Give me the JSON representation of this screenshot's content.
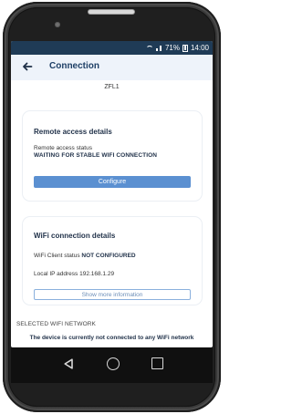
{
  "status_bar": {
    "battery": "71%",
    "time": "14:00"
  },
  "header": {
    "title": "Connection"
  },
  "device": {
    "name": "ZFL1"
  },
  "remote_access": {
    "title": "Remote access details",
    "status_label": "Remote access status",
    "status_value": "WAITING FOR STABLE WIFI CONNECTION",
    "configure_label": "Configure"
  },
  "wifi_details": {
    "title": "WiFi connection details",
    "client_status_label": "WiFi Client status",
    "client_status_value": "NOT CONFIGURED",
    "ip_label": "Local IP address",
    "ip_value": "192.168.1.29",
    "show_more_label": "Show more information"
  },
  "selected_network": {
    "label": "SELECTED WIFI NETWORK",
    "message": "The device is currently not connected to any WiFi network"
  },
  "icons": {
    "back": "arrow-left-icon",
    "wifi": "wifi-icon",
    "signal": "signal-icon",
    "battery": "battery-icon",
    "nav_back": "triangle-back-icon",
    "nav_home": "circle-home-icon",
    "nav_recent": "square-recent-icon"
  },
  "colors": {
    "status_bar": "#1f3b56",
    "header_background": "#eef3fa",
    "primary": "#5b90d1",
    "text_dark": "#1f3048"
  }
}
